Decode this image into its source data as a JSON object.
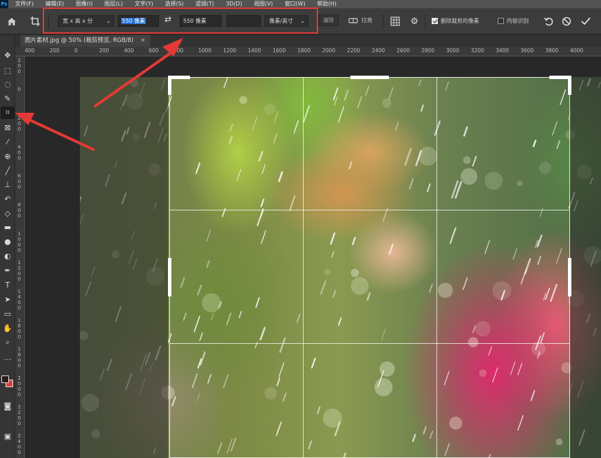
{
  "menu": {
    "logo": "Ps",
    "items": [
      "文件(F)",
      "编辑(E)",
      "图像(I)",
      "图层(L)",
      "文字(Y)",
      "选择(S)",
      "滤镜(T)",
      "3D(D)",
      "视图(V)",
      "窗口(W)",
      "帮助(H)"
    ]
  },
  "options": {
    "ratio_dropdown": "宽 x 高 x 分",
    "width_value": "550 像素",
    "height_value": "550 像素",
    "resolution_value": "",
    "unit_dropdown": "像素/英寸",
    "clear_label": "清除",
    "straighten_label": "拉直",
    "delete_cropped_label": "删除裁剪的像素",
    "delete_cropped_checked": true,
    "content_aware_label": "内容识别",
    "content_aware_checked": false
  },
  "document": {
    "tab_title": "图片素材.jpg @ 50% (裁剪预览, RGB/8)",
    "close_glyph": "×"
  },
  "ruler": {
    "top_labels": [
      "400",
      "200",
      "0",
      "200",
      "400",
      "600",
      "800",
      "1000",
      "1200",
      "1400",
      "1600",
      "1800",
      "2000",
      "2200",
      "2400",
      "2600",
      "2800",
      "3000",
      "3200",
      "3400",
      "3600",
      "3800",
      "4000"
    ],
    "left_labels": [
      "2\n0\n0",
      "0",
      "2\n0\n0",
      "4\n0\n0",
      "6\n0\n0",
      "8\n0\n0",
      "1\n0\n0\n0",
      "1\n2\n0\n0",
      "1\n4\n0\n0",
      "1\n6\n0\n0",
      "1\n8\n0\n0",
      "2\n0\n0\n0",
      "2\n2\n0\n0",
      "2\n4\n0\n0"
    ]
  },
  "tools": [
    {
      "name": "move-tool",
      "icon": "✥"
    },
    {
      "name": "marquee-tool",
      "icon": "⬚"
    },
    {
      "name": "lasso-tool",
      "icon": "◌"
    },
    {
      "name": "quick-select-tool",
      "icon": "✎"
    },
    {
      "name": "crop-tool",
      "icon": "⌗"
    },
    {
      "name": "frame-tool",
      "icon": "⊠"
    },
    {
      "name": "eyedropper-tool",
      "icon": "⁄"
    },
    {
      "name": "healing-brush-tool",
      "icon": "⊕"
    },
    {
      "name": "brush-tool",
      "icon": "╱"
    },
    {
      "name": "clone-stamp-tool",
      "icon": "⊥"
    },
    {
      "name": "history-brush-tool",
      "icon": "↶"
    },
    {
      "name": "eraser-tool",
      "icon": "◇"
    },
    {
      "name": "gradient-tool",
      "icon": "▬"
    },
    {
      "name": "blur-tool",
      "icon": "●"
    },
    {
      "name": "dodge-tool",
      "icon": "◐"
    },
    {
      "name": "pen-tool",
      "icon": "✒"
    },
    {
      "name": "type-tool",
      "icon": "T"
    },
    {
      "name": "path-select-tool",
      "icon": "➤"
    },
    {
      "name": "rectangle-tool",
      "icon": "▭"
    },
    {
      "name": "hand-tool",
      "icon": "✋"
    },
    {
      "name": "zoom-tool",
      "icon": "⌕"
    },
    {
      "name": "edit-toolbar",
      "icon": "⋯"
    }
  ],
  "colors": {
    "foreground": "#2b1a17",
    "background": "#d6423a",
    "annotation": "#e53935"
  }
}
